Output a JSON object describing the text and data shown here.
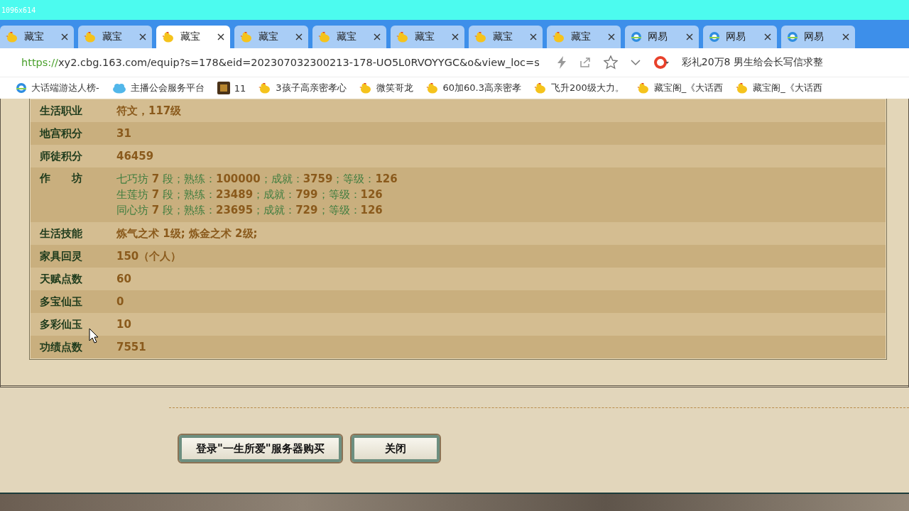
{
  "capture_label": "1096x614",
  "tabs": [
    {
      "title": "藏宝",
      "kind": "chick",
      "selected": false
    },
    {
      "title": "藏宝",
      "kind": "chick",
      "selected": false
    },
    {
      "title": "藏宝",
      "kind": "chick",
      "selected": true
    },
    {
      "title": "藏宝",
      "kind": "chick",
      "selected": false
    },
    {
      "title": "藏宝",
      "kind": "chick",
      "selected": false
    },
    {
      "title": "藏宝",
      "kind": "chick",
      "selected": false
    },
    {
      "title": "藏宝",
      "kind": "chick",
      "selected": false
    },
    {
      "title": "藏宝",
      "kind": "chick",
      "selected": false
    },
    {
      "title": "网易",
      "kind": "globe",
      "selected": false
    },
    {
      "title": "网易",
      "kind": "globe",
      "selected": false
    },
    {
      "title": "网易",
      "kind": "globe",
      "selected": false
    }
  ],
  "address": {
    "scheme": "https://",
    "rest": "xy2.cbg.163.com/equip?s=178&eid=202307032300213-178-UO5L0RVOYYGC&o&view_loc=s"
  },
  "news": "彩礼20万8 男生给会长写信求整",
  "bookmarks": [
    {
      "title": "大话端游达人榜-",
      "kind": "globe"
    },
    {
      "title": "主播公会服务平台",
      "kind": "cloud"
    },
    {
      "title": "11",
      "kind": "game"
    },
    {
      "title": "3孩子高亲密孝心",
      "kind": "chick"
    },
    {
      "title": "微笑哥龙",
      "kind": "chick"
    },
    {
      "title": "60加60.3高亲密孝",
      "kind": "chick"
    },
    {
      "title": "飞升200级大力。",
      "kind": "chick"
    },
    {
      "title": "藏宝阁_《大话西",
      "kind": "chick"
    },
    {
      "title": "藏宝阁_《大话西",
      "kind": "chick"
    }
  ],
  "info_rows": [
    {
      "label": "生活职业",
      "values": [
        "符文，117级"
      ]
    },
    {
      "label": "地宫积分",
      "values": [
        "31"
      ]
    },
    {
      "label": "师徒积分",
      "values": [
        "46459"
      ]
    },
    {
      "label": "作　　坊",
      "kind": "workshop",
      "values": [
        "七巧坊 **7** 段；熟练：**100000**；成就：**3759**；等级：**126**",
        "生莲坊 **7** 段；熟练：**23489**；成就：**799**；等级：**126**",
        "同心坊 **7** 段；熟练：**23695**；成就：**729**；等级：**126**"
      ]
    },
    {
      "label": "生活技能",
      "values": [
        "炼气之术 1级; 炼金之术 2级;"
      ]
    },
    {
      "label": "家具回灵",
      "values": [
        "150（个人）"
      ]
    },
    {
      "label": "天赋点数",
      "values": [
        "60"
      ]
    },
    {
      "label": "多宝仙玉",
      "values": [
        "0"
      ]
    },
    {
      "label": "多彩仙玉",
      "values": [
        "10"
      ]
    },
    {
      "label": "功绩点数",
      "values": [
        "7551"
      ]
    }
  ],
  "buttons": [
    "登录\"一生所爱\"服务器购买",
    "关闭"
  ]
}
